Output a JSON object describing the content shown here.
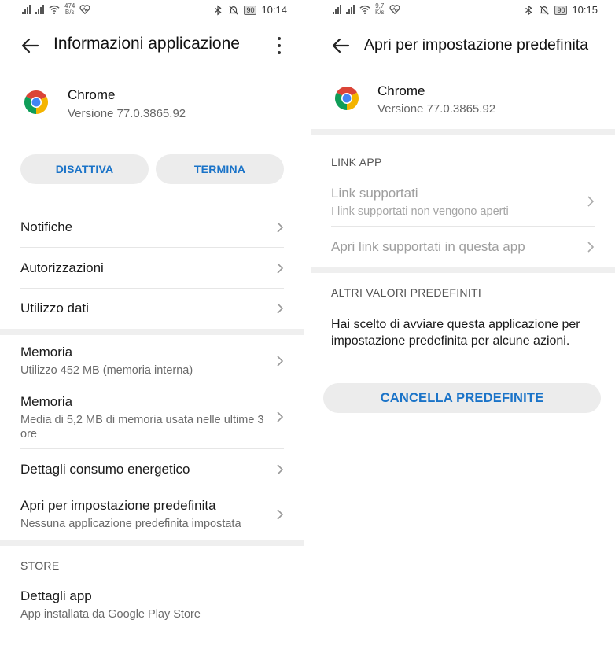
{
  "left": {
    "status": {
      "speed_value": "474",
      "speed_unit": "B/s",
      "battery": "90",
      "time": "10:14"
    },
    "title": "Informazioni applicazione",
    "app": {
      "name": "Chrome",
      "version": "Versione 77.0.3865.92"
    },
    "buttons": {
      "disable": "DISATTIVA",
      "stop": "TERMINA"
    },
    "items": [
      {
        "title": "Notifiche"
      },
      {
        "title": "Autorizzazioni"
      },
      {
        "title": "Utilizzo dati"
      },
      {
        "title": "Memoria",
        "subtitle": "Utilizzo 452 MB (memoria interna)"
      },
      {
        "title": "Memoria",
        "subtitle": "Media di 5,2 MB di memoria usata nelle ultime 3 ore"
      },
      {
        "title": "Dettagli consumo energetico"
      },
      {
        "title": "Apri per impostazione predefinita",
        "subtitle": "Nessuna applicazione predefinita impostata"
      }
    ],
    "store_header": "STORE",
    "store_item": {
      "title": "Dettagli app",
      "subtitle": "App installata da Google Play Store"
    }
  },
  "right": {
    "status": {
      "speed_value": "9,7",
      "speed_unit": "K/s",
      "battery": "90",
      "time": "10:15"
    },
    "title": "Apri per impostazione predefinita",
    "app": {
      "name": "Chrome",
      "version": "Versione 77.0.3865.92"
    },
    "link_header": "LINK APP",
    "links": [
      {
        "title": "Link supportati",
        "subtitle": "I link supportati non vengono aperti"
      },
      {
        "title": "Apri link supportati in questa app"
      }
    ],
    "other_header": "ALTRI VALORI PREDEFINITI",
    "other_text": "Hai scelto di avviare questa applicazione per impostazione predefinita per alcune azioni.",
    "clear_button": "CANCELLA PREDEFINITE"
  },
  "icons": {
    "back": "arrow-left-icon",
    "more": "more-vert-icon",
    "chevron": "chevron-right-icon",
    "app": "chrome-logo-icon"
  },
  "colors": {
    "accent": "#1a73c8",
    "button_bg": "#ececec",
    "band": "#efefef"
  }
}
